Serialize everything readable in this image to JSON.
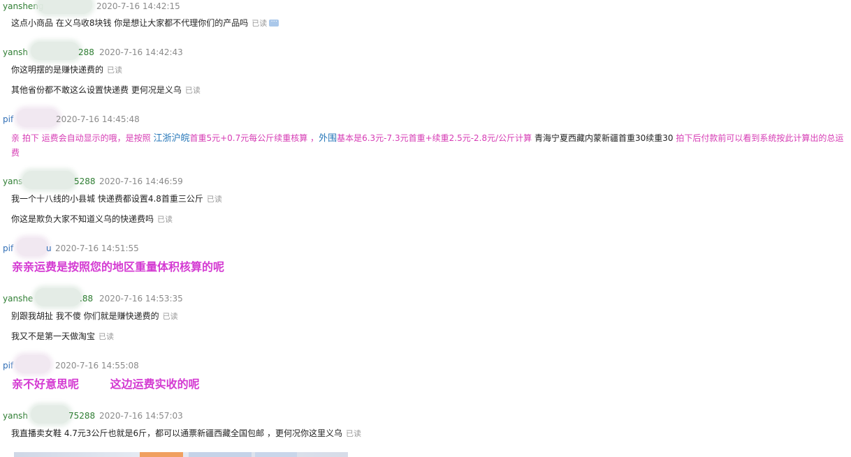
{
  "read_label": "已读",
  "messages": [
    {
      "sender": "yansheng",
      "time": "2020-7-16 14:42:15",
      "lines": [
        "这点小商品 在义乌收8块钱 你是想让大家都不代理你们的产品吗"
      ]
    },
    {
      "sender": "yansh",
      "sender_suffix": "288",
      "time": "2020-7-16 14:42:43",
      "lines": [
        "你这明摆的是赚快递费的",
        "其他省份都不敢这么设置快递费 更何况是义乌"
      ]
    },
    {
      "sender": "pif",
      "time": "2020-7-16 14:45:48",
      "rich": {
        "p1": "亲 拍下 运费会自动显示的哦，是按照 ",
        "p2": "江浙沪皖",
        "p3": "首重5元+0.7元每公斤续重核算 ，",
        "p4": "外围",
        "p5": "基本是6.3元-7.3元首重+续重2.5元-2.8元/公斤计算 ",
        "p6": "青海宁夏西藏内蒙新疆首重30续重30 ",
        "p7": "拍下后付款前可以看到系统按此计算出的总运费"
      }
    },
    {
      "sender": "yans",
      "sender_suffix": "5288",
      "time": "2020-7-16 14:46:59",
      "lines": [
        "我一个十八线的小县城 快递费都设置4.8首重三公斤",
        "你这是欺负大家不知道义乌的快递费吗"
      ]
    },
    {
      "sender": "pif",
      "sender_suffix": "u",
      "time": "2020-7-16 14:51:55",
      "big": "亲亲运费是按照您的地区重量体积核算的呢"
    },
    {
      "sender": "yanshe",
      "sender_suffix": ".88",
      "time": "2020-7-16 14:53:35",
      "lines": [
        "别跟我胡扯 我不傻  你们就是赚快递费的",
        "我又不是第一天做淘宝"
      ]
    },
    {
      "sender": "pif",
      "time": "2020-7-16 14:55:08",
      "big": "亲不好意思呢        这边运费实收的呢"
    },
    {
      "sender": "yansh",
      "sender_suffix": "75288",
      "time": "2020-7-16 14:57:03",
      "lines": [
        "我直播卖女鞋 4.7元3公斤也就是6斤，都可以通票新疆西藏全国包邮 ，更何况你这里义乌"
      ]
    }
  ]
}
